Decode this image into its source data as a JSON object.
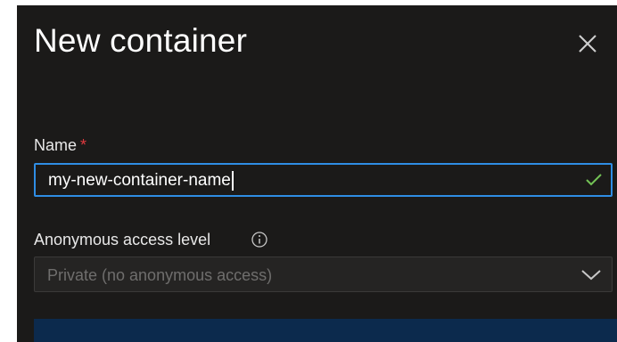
{
  "panel": {
    "title": "New container"
  },
  "name_field": {
    "label": "Name",
    "required_marker": "*",
    "value": "my-new-container-name",
    "valid": true
  },
  "access_field": {
    "label": "Anonymous access level",
    "selected": "Private (no anonymous access)"
  },
  "icons": {
    "close": "close-icon",
    "valid": "checkmark-icon",
    "info": "info-icon",
    "dropdown": "chevron-down-icon"
  },
  "colors": {
    "panel_background": "#1b1a19",
    "focus_border": "#2f8de4",
    "required": "#e0393e",
    "valid_check": "#73c255",
    "info_box": "#0c2a4d"
  }
}
